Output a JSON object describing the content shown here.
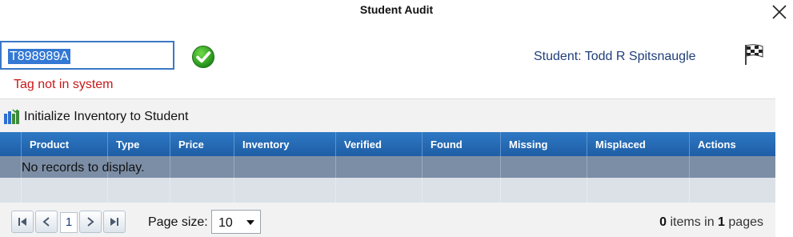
{
  "window": {
    "title": "Student Audit"
  },
  "tag": {
    "value": "T898989A",
    "error": "Tag not in system"
  },
  "student": {
    "label": "Student: Todd R Spitsnaugle"
  },
  "toolbar": {
    "initialize_label": "Initialize Inventory to Student"
  },
  "grid": {
    "columns": [
      "Product",
      "Type",
      "Price",
      "Inventory",
      "Verified",
      "Found",
      "Missing",
      "Misplaced",
      "Actions"
    ],
    "empty_text": "No records to display."
  },
  "pager": {
    "current_page": "1",
    "page_size_label": "Page size:",
    "page_size": "10",
    "items_count": "0",
    "items_text": "items in",
    "pages_count": "1",
    "pages_text": "pages"
  },
  "colors": {
    "header": "#1e5ea6",
    "error": "#c91818",
    "link": "#1f3f7a",
    "selection": "#3378d4"
  },
  "icons": [
    "close-icon",
    "check-circle-icon",
    "checkered-flag-icon",
    "initialize-inventory-icon",
    "first-page-icon",
    "prev-page-icon",
    "next-page-icon",
    "last-page-icon",
    "dropdown-arrow-icon"
  ]
}
